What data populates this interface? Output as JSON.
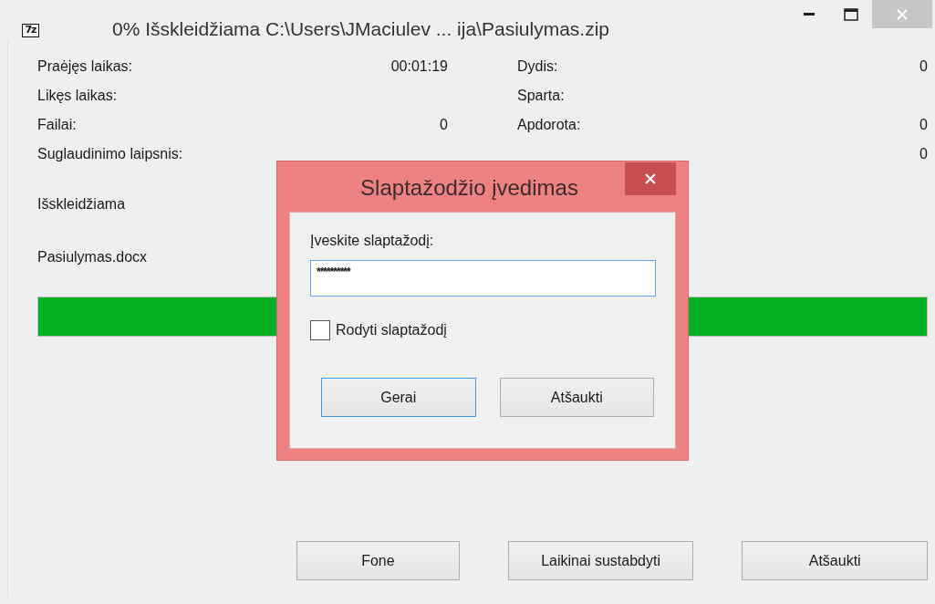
{
  "window": {
    "title": "0% Išskleidžiama C:\\Users\\JMaciulev ... ija\\Pasiulymas.zip",
    "app_icon_text": "7z"
  },
  "stats_left": [
    {
      "label": "Praėjęs laikas:",
      "value": "00:01:19"
    },
    {
      "label": "Likęs laikas:"
    },
    {
      "label": "Failai:",
      "value": "0"
    },
    {
      "label": "Suglaudinimo laipsnis:"
    }
  ],
  "stats_right": [
    {
      "label": "Dydis:",
      "value": "0"
    },
    {
      "label": "Sparta:"
    },
    {
      "label": "Apdorota:",
      "value": "0"
    },
    {
      "value": "0"
    }
  ],
  "operation": "Išskleidžiama",
  "current_file": "Pasiulymas.docx",
  "progress": {
    "level": 1
  },
  "buttons": [
    {
      "label": "Fone"
    },
    {
      "label": "Laikinai sustabdyti"
    },
    {
      "label": "Atšaukti"
    }
  ],
  "dialog": {
    "title": "Slaptažodžio įvedimas",
    "prompt": "Įveskite slaptažodį:",
    "password": "**********",
    "show_password": {
      "label": "Rodyti slaptažodį",
      "checked": false
    },
    "buttons": [
      {
        "label": "Gerai",
        "selected": true
      },
      {
        "label": "Atšaukti",
        "selected": false
      }
    ]
  }
}
